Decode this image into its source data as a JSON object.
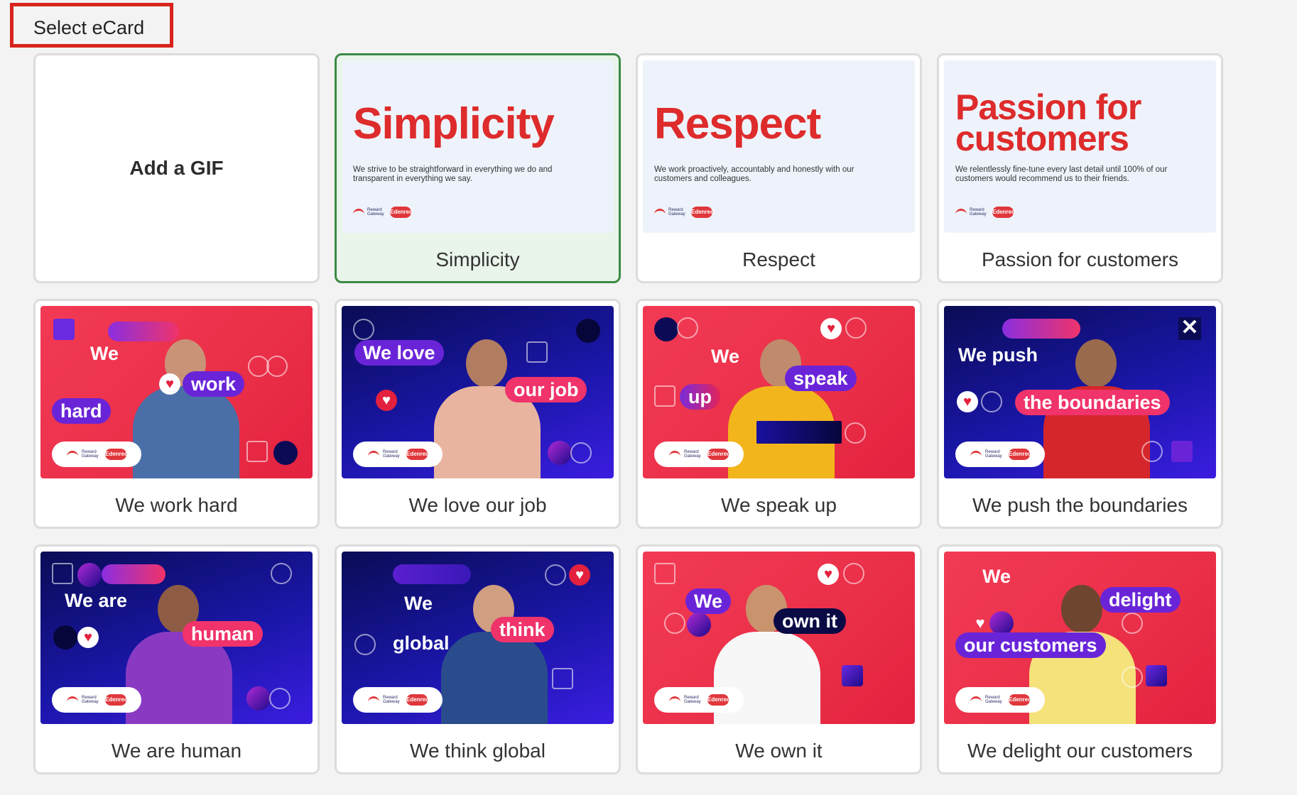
{
  "header": {
    "title": "Select eCard"
  },
  "cards": [
    {
      "label": "Add a GIF"
    },
    {
      "label": "Simplicity",
      "headline": "Simplicity",
      "description": "We strive to be straightforward in everything we do and transparent in everything we say.",
      "selected": true
    },
    {
      "label": "Respect",
      "headline": "Respect",
      "description": "We work proactively, accountably and honestly with our customers and colleagues."
    },
    {
      "label": "Passion for customers",
      "headline_line1": "Passion for",
      "headline_line2": "customers",
      "description": "We relentlessly fine-tune every last detail until 100% of our customers would recommend us to their friends."
    },
    {
      "label": "We work hard",
      "words": [
        "We",
        "work",
        "hard"
      ]
    },
    {
      "label": "We love our job",
      "words": [
        "We love",
        "our job"
      ]
    },
    {
      "label": "We speak up",
      "words": [
        "We",
        "speak",
        "up"
      ]
    },
    {
      "label": "We push the boundaries",
      "words": [
        "We push",
        "the boundaries"
      ]
    },
    {
      "label": "We are human",
      "words": [
        "We are",
        "human"
      ]
    },
    {
      "label": "We think global",
      "words": [
        "We",
        "think",
        "global"
      ]
    },
    {
      "label": "We own it",
      "words": [
        "We",
        "own it"
      ]
    },
    {
      "label": "We delight our customers",
      "words": [
        "We",
        "delight",
        "our customers"
      ]
    }
  ],
  "logo": {
    "rg_text": "Reward Gateway",
    "edenred_text": "Edenred"
  },
  "colors": {
    "accent_red": "#de2b2b",
    "selected_border": "#3c8a46",
    "header_outline": "#d9231d"
  }
}
